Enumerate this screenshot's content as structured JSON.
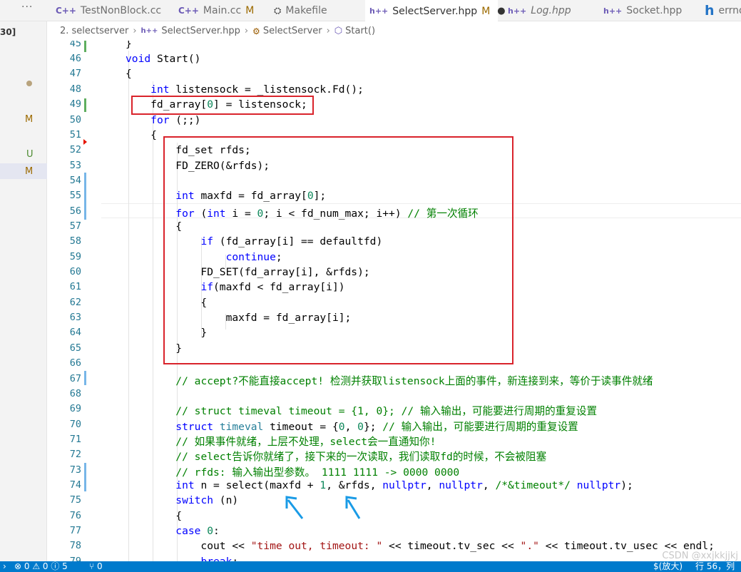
{
  "tabs": [
    {
      "icon": "C++",
      "label": "TestNonBlock.cc",
      "modified": ""
    },
    {
      "icon": "C++",
      "label": "Main.cc",
      "modified": "M"
    },
    {
      "icon": "makefile",
      "label": "Makefile",
      "modified": ""
    },
    {
      "icon": "h++",
      "label": "SelectServer.hpp",
      "modified": "M"
    },
    {
      "icon": "h++",
      "label": "Log.hpp",
      "modified": ""
    },
    {
      "icon": "h++",
      "label": "Socket.hpp",
      "modified": ""
    },
    {
      "icon": "h",
      "label": "errno",
      "modified": ""
    }
  ],
  "more_label": "···",
  "breadcrumb": {
    "folder": "2. selectserver",
    "file_icon": "h++",
    "file": "SelectServer.hpp",
    "class": "SelectServer",
    "method": "Start()"
  },
  "sidebar": {
    "cut_label": "30]",
    "m1": "M",
    "u": "U",
    "m2": "M"
  },
  "line_numbers": [
    "45",
    "46",
    "47",
    "48",
    "49",
    "50",
    "51",
    "52",
    "53",
    "54",
    "55",
    "56",
    "57",
    "58",
    "59",
    "60",
    "61",
    "62",
    "63",
    "64",
    "65",
    "66",
    "67",
    "68",
    "69",
    "70",
    "71",
    "72",
    "73",
    "74",
    "75",
    "76",
    "77",
    "78",
    "79"
  ],
  "status": {
    "problems": "⊗ 0 ⚠ 0 ⓘ 5",
    "ports": "⑂ 0",
    "right1": "$(放大)",
    "right2": "行 56，列"
  },
  "watermark": "CSDN @xxjkkjjkj",
  "colors": {
    "accent": "#007acc",
    "highlight_box": "#d9232b",
    "arrow": "#1a9be6"
  }
}
